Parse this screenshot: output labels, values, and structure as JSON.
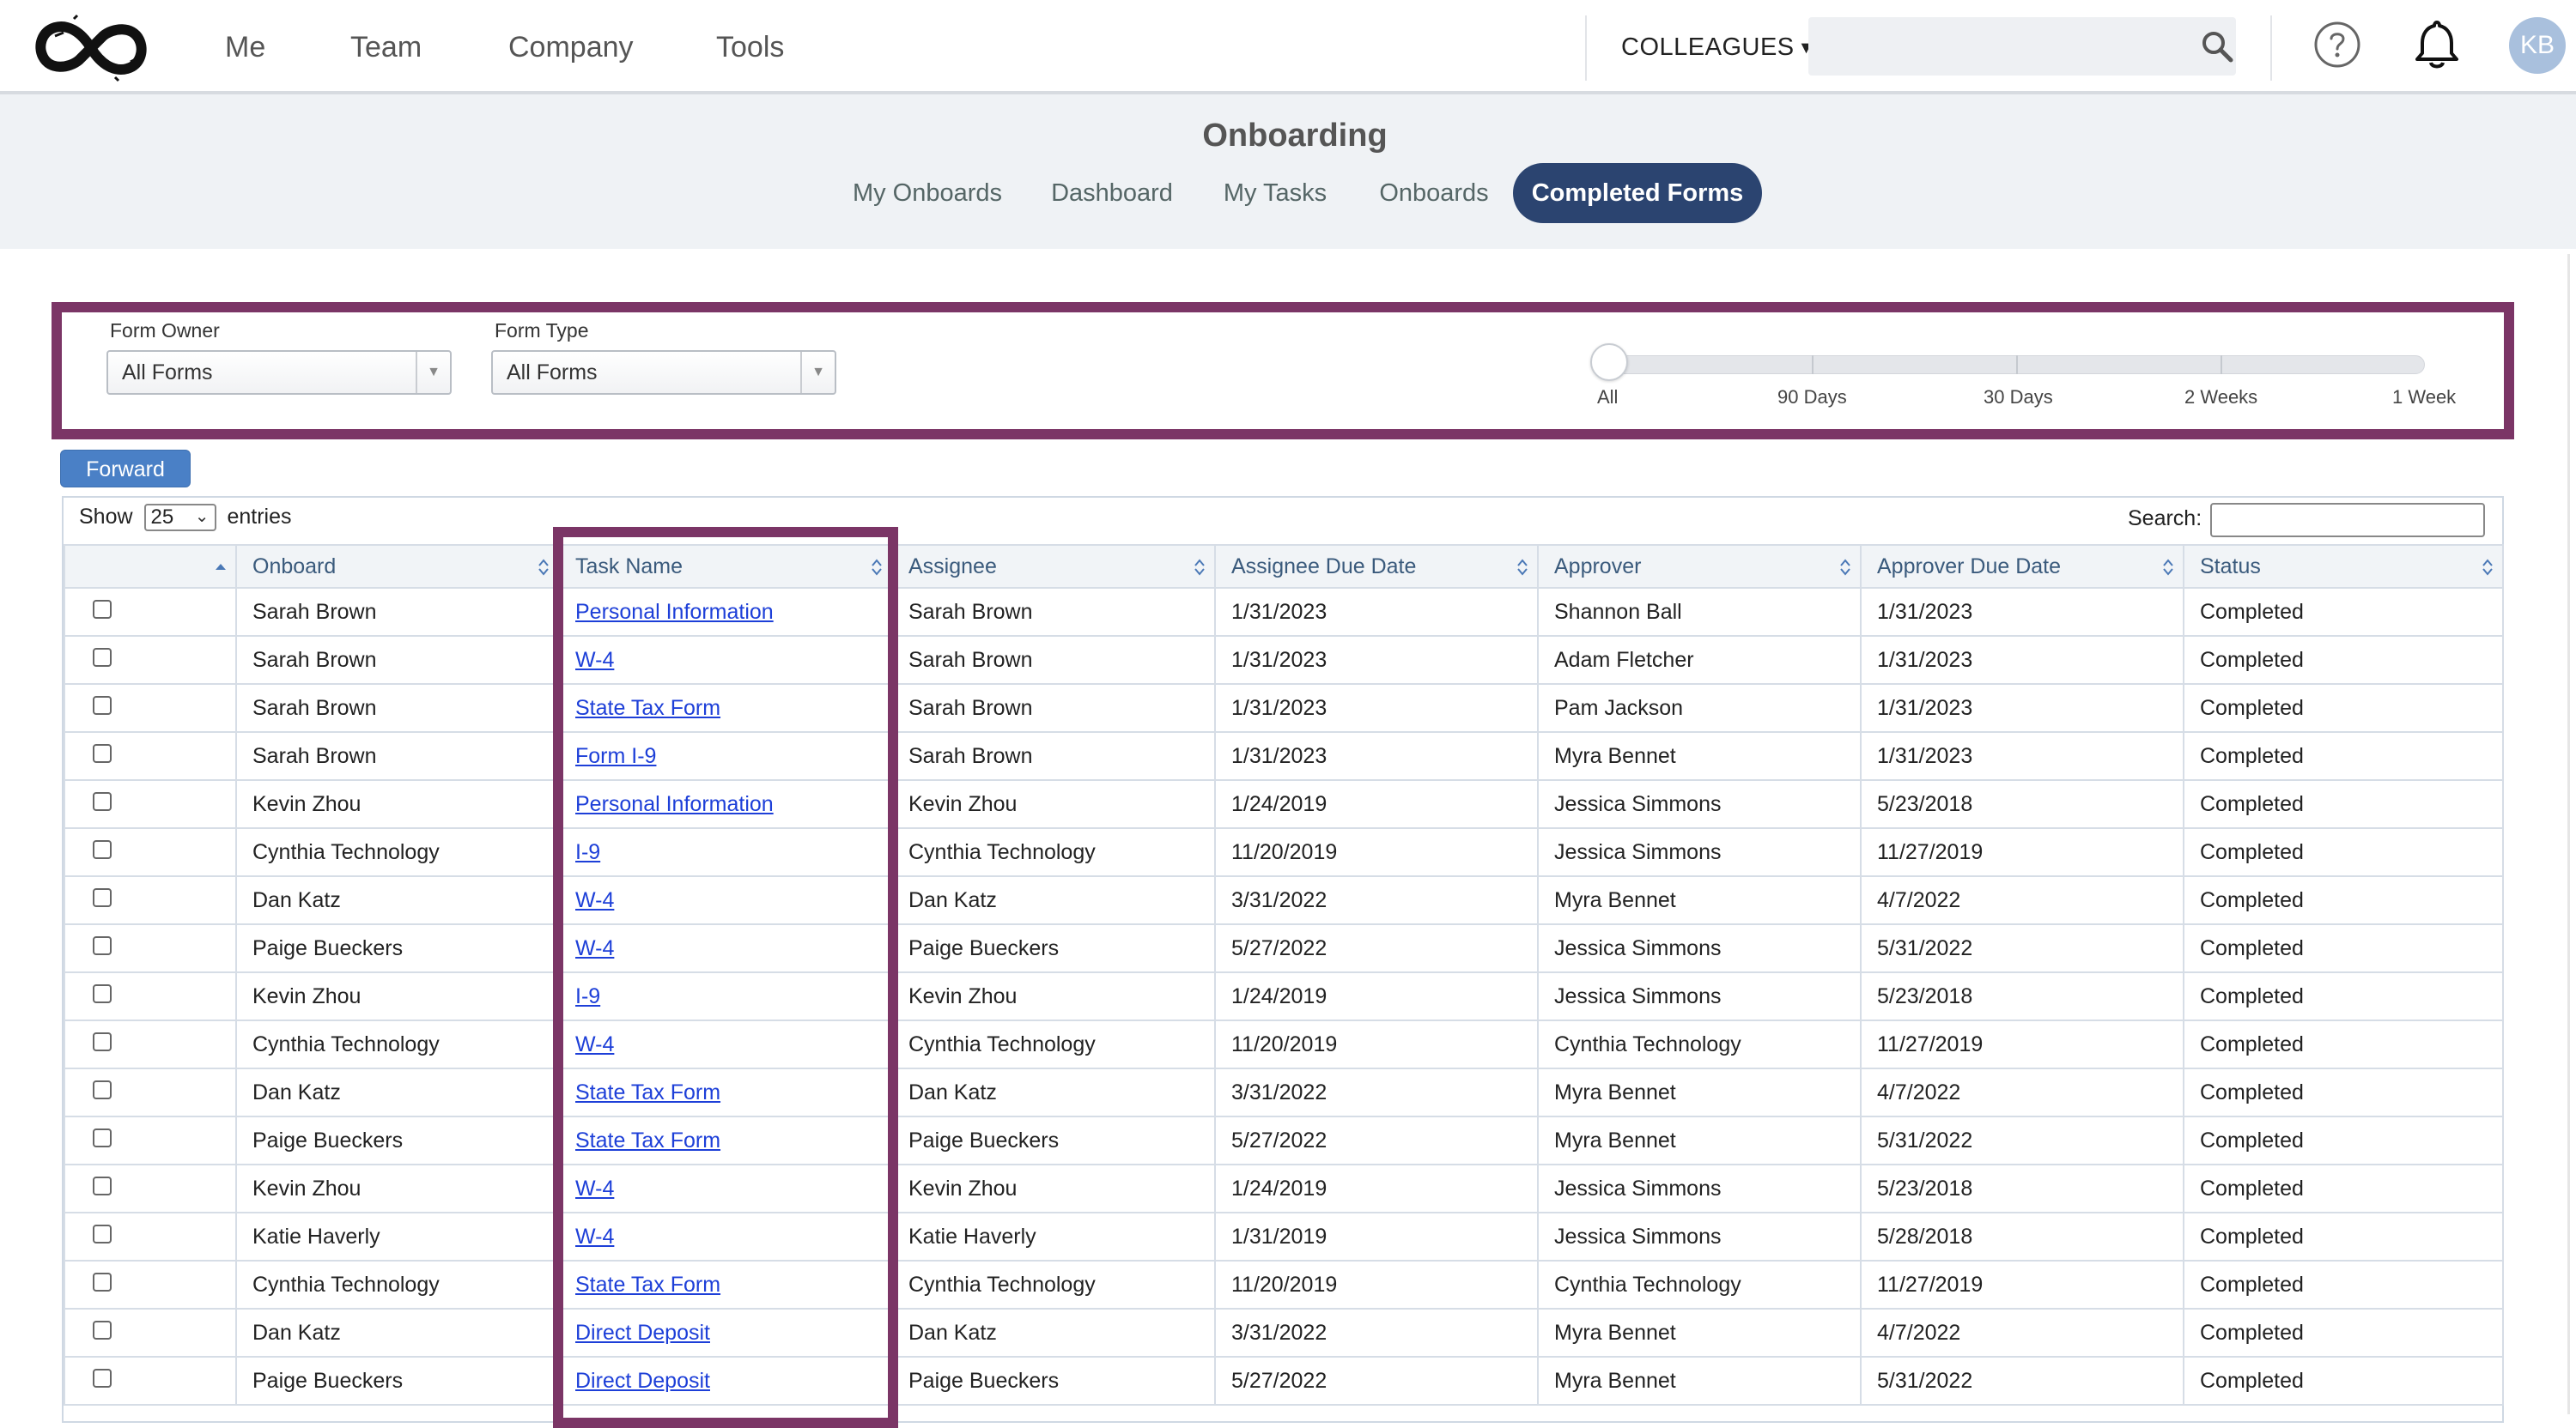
{
  "topnav": {
    "links": [
      "Me",
      "Team",
      "Company",
      "Tools"
    ],
    "colleagues_label": "COLLEAGUES",
    "search_placeholder": "",
    "avatar_initials": "KB"
  },
  "header": {
    "title": "Onboarding",
    "tabs": [
      "My Onboards",
      "Dashboard",
      "My Tasks",
      "Onboards",
      "Completed Forms"
    ],
    "active_tab": "Completed Forms"
  },
  "filters": {
    "form_owner_label": "Form Owner",
    "form_owner_value": "All Forms",
    "form_type_label": "Form Type",
    "form_type_value": "All Forms",
    "range_labels": [
      "All",
      "90 Days",
      "30 Days",
      "2 Weeks",
      "1 Week"
    ],
    "range_selected": "All"
  },
  "forward_label": "Forward",
  "table_controls": {
    "show_label": "Show",
    "entries_value": "25",
    "entries_label": "entries",
    "search_label": "Search:"
  },
  "table": {
    "columns": [
      "",
      "Onboard",
      "Task Name",
      "Assignee",
      "Assignee Due Date",
      "Approver",
      "Approver Due Date",
      "Status"
    ],
    "rows": [
      {
        "onboard": "Sarah Brown",
        "task": "Personal Information",
        "assignee": "Sarah Brown",
        "assignee_due": "1/31/2023",
        "approver": "Shannon Ball",
        "approver_due": "1/31/2023",
        "status": "Completed"
      },
      {
        "onboard": "Sarah Brown",
        "task": "W-4",
        "assignee": "Sarah Brown",
        "assignee_due": "1/31/2023",
        "approver": "Adam Fletcher",
        "approver_due": "1/31/2023",
        "status": "Completed"
      },
      {
        "onboard": "Sarah Brown",
        "task": "State Tax Form",
        "assignee": "Sarah Brown",
        "assignee_due": "1/31/2023",
        "approver": "Pam Jackson",
        "approver_due": "1/31/2023",
        "status": "Completed"
      },
      {
        "onboard": "Sarah Brown",
        "task": "Form I-9",
        "assignee": "Sarah Brown",
        "assignee_due": "1/31/2023",
        "approver": "Myra Bennet",
        "approver_due": "1/31/2023",
        "status": "Completed"
      },
      {
        "onboard": "Kevin Zhou",
        "task": "Personal Information",
        "assignee": "Kevin Zhou",
        "assignee_due": "1/24/2019",
        "approver": "Jessica Simmons",
        "approver_due": "5/23/2018",
        "status": "Completed"
      },
      {
        "onboard": "Cynthia Technology",
        "task": "I-9",
        "assignee": "Cynthia Technology",
        "assignee_due": "11/20/2019",
        "approver": "Jessica Simmons",
        "approver_due": "11/27/2019",
        "status": "Completed"
      },
      {
        "onboard": "Dan Katz",
        "task": "W-4",
        "assignee": "Dan Katz",
        "assignee_due": "3/31/2022",
        "approver": "Myra Bennet",
        "approver_due": "4/7/2022",
        "status": "Completed"
      },
      {
        "onboard": "Paige Bueckers",
        "task": "W-4",
        "assignee": "Paige Bueckers",
        "assignee_due": "5/27/2022",
        "approver": "Jessica Simmons",
        "approver_due": "5/31/2022",
        "status": "Completed"
      },
      {
        "onboard": "Kevin Zhou",
        "task": "I-9",
        "assignee": "Kevin Zhou",
        "assignee_due": "1/24/2019",
        "approver": "Jessica Simmons",
        "approver_due": "5/23/2018",
        "status": "Completed"
      },
      {
        "onboard": "Cynthia Technology",
        "task": "W-4",
        "assignee": "Cynthia Technology",
        "assignee_due": "11/20/2019",
        "approver": "Cynthia Technology",
        "approver_due": "11/27/2019",
        "status": "Completed"
      },
      {
        "onboard": "Dan Katz",
        "task": "State Tax Form",
        "assignee": "Dan Katz",
        "assignee_due": "3/31/2022",
        "approver": "Myra Bennet",
        "approver_due": "4/7/2022",
        "status": "Completed"
      },
      {
        "onboard": "Paige Bueckers",
        "task": "State Tax Form",
        "assignee": "Paige Bueckers",
        "assignee_due": "5/27/2022",
        "approver": "Myra Bennet",
        "approver_due": "5/31/2022",
        "status": "Completed"
      },
      {
        "onboard": "Kevin Zhou",
        "task": "W-4",
        "assignee": "Kevin Zhou",
        "assignee_due": "1/24/2019",
        "approver": "Jessica Simmons",
        "approver_due": "5/23/2018",
        "status": "Completed"
      },
      {
        "onboard": "Katie Haverly",
        "task": "W-4",
        "assignee": "Katie Haverly",
        "assignee_due": "1/31/2019",
        "approver": "Jessica Simmons",
        "approver_due": "5/28/2018",
        "status": "Completed"
      },
      {
        "onboard": "Cynthia Technology",
        "task": "State Tax Form",
        "assignee": "Cynthia Technology",
        "assignee_due": "11/20/2019",
        "approver": "Cynthia Technology",
        "approver_due": "11/27/2019",
        "status": "Completed"
      },
      {
        "onboard": "Dan Katz",
        "task": "Direct Deposit",
        "assignee": "Dan Katz",
        "assignee_due": "3/31/2022",
        "approver": "Myra Bennet",
        "approver_due": "4/7/2022",
        "status": "Completed"
      },
      {
        "onboard": "Paige Bueckers",
        "task": "Direct Deposit",
        "assignee": "Paige Bueckers",
        "assignee_due": "5/27/2022",
        "approver": "Myra Bennet",
        "approver_due": "5/31/2022",
        "status": "Completed"
      }
    ]
  },
  "colors": {
    "highlight": "#7b3566",
    "active_tab_bg": "#2b4470",
    "link": "#1d3fd8",
    "button": "#4a80c6"
  },
  "icons": [
    "infinity-logo-icon",
    "search-icon",
    "help-icon",
    "bell-icon",
    "sort-icon",
    "chevron-down-icon"
  ]
}
